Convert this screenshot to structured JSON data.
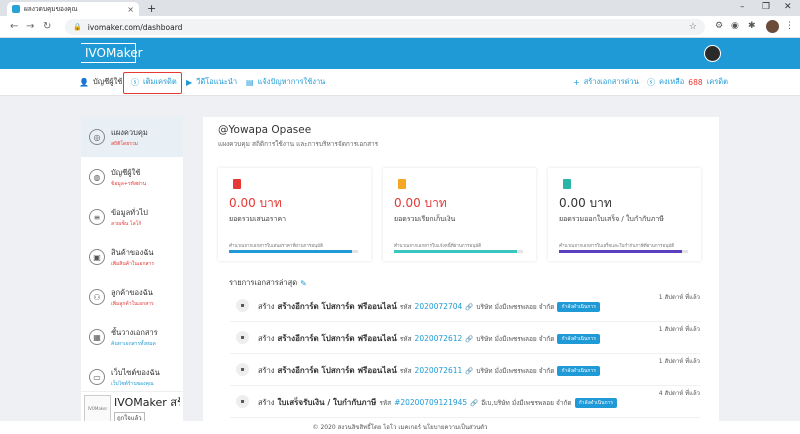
{
  "browser": {
    "tab_title": "ผลงวดบคุมของคุณ",
    "url": "ivomaker.com/dashboard"
  },
  "app": {
    "logo_text": "IVOMaker"
  },
  "subnav": {
    "account": "บัญชีผู้ใช้",
    "add_credit": "เติมเครดิต",
    "video_guide": "วีดีโอแนะนำ",
    "report_problem": "แจ้งปัญหาการใช้งาน",
    "create_quick_doc": "สร้างเอกสารด่วน",
    "credit_prefix": "คงเหลือ",
    "credit_amount": "688",
    "credit_suffix": "เครดิต"
  },
  "sidebar": {
    "items": [
      {
        "label": "แผงควบคุม",
        "sub": "สถิติโดยรวม",
        "icon": "dashboard-icon"
      },
      {
        "label": "บัญชีผู้ใช้",
        "sub": "ข้อมูล+รหัสผ่าน",
        "icon": "user-account-icon"
      },
      {
        "label": "ข้อมูลทั่วไป",
        "sub": "ลายเซ็น โลโก้",
        "icon": "database-icon"
      },
      {
        "label": "สินค้าของฉัน",
        "sub": "เพิ่มสินค้าในเอกสาร",
        "icon": "product-icon"
      },
      {
        "label": "ลูกค้าของฉัน",
        "sub": "เพิ่มลูกค้าในเอกสาร",
        "icon": "customers-icon"
      },
      {
        "label": "ชั้นวางเอกสาร",
        "sub": "ค้นหาเอกสารทั้งหมด",
        "icon": "documents-icon"
      },
      {
        "label": "เว็บไซต์ของฉัน",
        "sub": "เว็บไซต์ร้านของคุณ",
        "icon": "website-icon"
      }
    ],
    "shop_name": "IVOMaker สร้า...",
    "shop_like": "ถูกใจแล้ว",
    "shop_thumb_text": "IVOMaker"
  },
  "main": {
    "greeting": "@Yowapa Opasee",
    "greeting_sub": "แผงควบคุม สถิติการใช้งาน และการบริหารจัดการเอกสาร",
    "stats": [
      {
        "value": "0.00 บาท",
        "label": "ยอดรวมเสนอราคา",
        "note": "คำนวณจากเอกสารใบเสนอราคาที่ผ่านการอนุมัติ",
        "color": "#e53935",
        "fill": 0.95
      },
      {
        "value": "0.00 บาท",
        "label": "ยอดรวมเรียกเก็บเงิน",
        "note": "คำนวณจากเอกสารใบแจ้งหนี้ที่ผ่านการอนุมัติ",
        "color": "#f5a623",
        "fill": 0.95
      },
      {
        "value": "0.00 บาท",
        "label": "ยอดรวมออกใบเสร็จ / ใบกำกับภาษี",
        "note": "คำนวณจากเอกสารใบเสร็จและใบกำกับภาษีที่ผ่านการอนุมัติ",
        "color": "#2bb5a6",
        "fill": 0.95
      }
    ],
    "stat_fill_colors": [
      "#1f9ad6",
      "#38c7c0",
      "#5c3fc1"
    ],
    "recent_title": "รายการเอกสารล่าสุด",
    "docs": [
      {
        "action": "สร้าง",
        "title": "สร้างอีการ์ด โปสการ์ด ฟรีออนไลน์",
        "code_label": "รหัส",
        "code": "2020072704",
        "company": "บริษัท มั่งมีเพชรพลอย จำกัด",
        "status": "กำลังดำเนินการ",
        "time": "1 สัปดาห์ ที่แล้ว"
      },
      {
        "action": "สร้าง",
        "title": "สร้างอีการ์ด โปสการ์ด ฟรีออนไลน์",
        "code_label": "รหัส",
        "code": "2020072612",
        "company": "บริษัท มั่งมีเพชรพลอย จำกัด",
        "status": "กำลังดำเนินการ",
        "time": "1 สัปดาห์ ที่แล้ว"
      },
      {
        "action": "สร้าง",
        "title": "สร้างอีการ์ด โปสการ์ด ฟรีออนไลน์",
        "code_label": "รหัส",
        "code": "2020072611",
        "company": "บริษัท มั่งมีเพชรพลอย จำกัด",
        "status": "กำลังดำเนินการ",
        "time": "1 สัปดาห์ ที่แล้ว"
      },
      {
        "action": "สร้าง",
        "title": "ใบเสร็จรับเงิน / ใบกำกับภาษี",
        "code_label": "รหัส",
        "code": "#20200709121945",
        "company": "อีเบ,บริษัท มั่งมีเพชรพลอย จำกัด",
        "status": "กำลังดำเนินการ",
        "time": "4 สัปดาห์ ที่แล้ว"
      }
    ]
  },
  "footer": {
    "text": "© 2020 สงวนลิขสิทธิ์โดย ไอโว เมคเกอร์ นโยบายความเป็นส่วนตัว"
  }
}
